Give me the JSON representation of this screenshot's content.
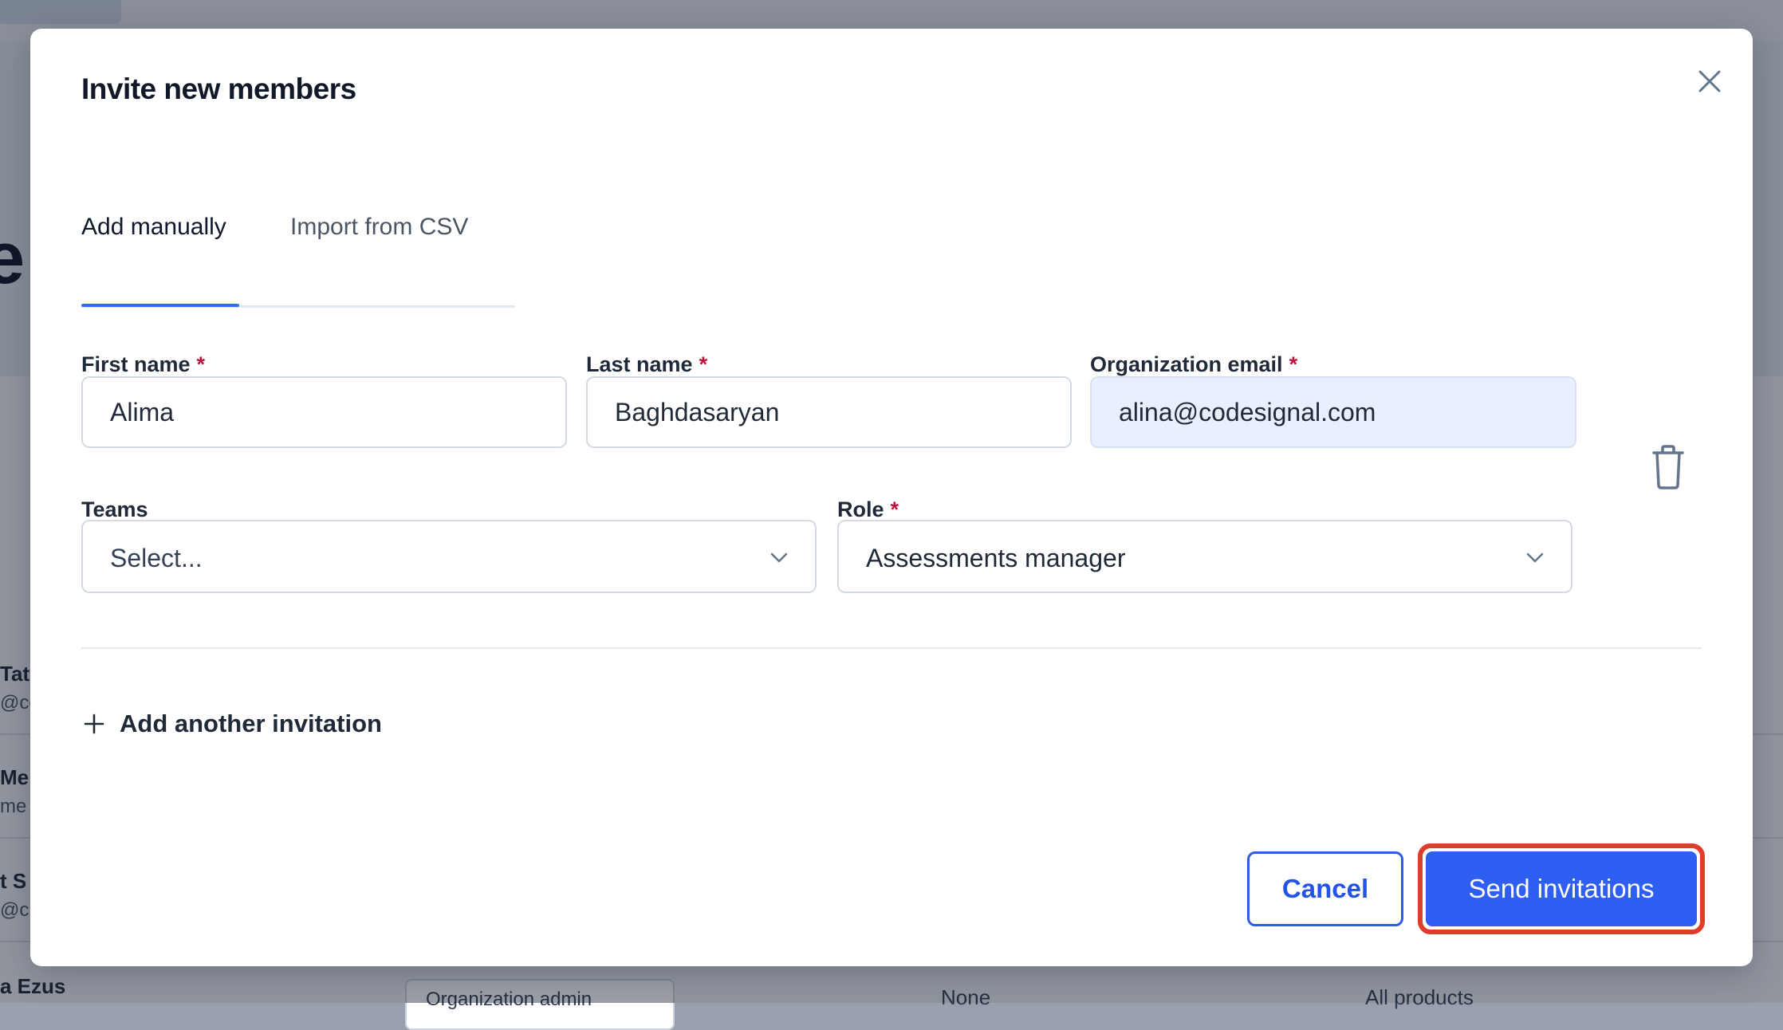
{
  "background": {
    "rows": [
      {
        "name": "Tat",
        "email": "@co"
      },
      {
        "name": "Me",
        "email": "me"
      },
      {
        "name": "t S",
        "email": "@c"
      }
    ],
    "last_row": {
      "name": "a Ezus",
      "role": "Organization admin",
      "teams": "None",
      "products": "All products"
    }
  },
  "modal": {
    "title": "Invite new members",
    "tabs": [
      {
        "label": "Add manually",
        "active": true
      },
      {
        "label": "Import from CSV",
        "active": false
      }
    ],
    "fields": {
      "first_name": {
        "label": "First name",
        "required_mark": "*",
        "value": "Alima"
      },
      "last_name": {
        "label": "Last name",
        "required_mark": "*",
        "value": "Baghdasaryan"
      },
      "email": {
        "label": "Organization email",
        "required_mark": "*",
        "value": "alina@codesignal.com"
      },
      "teams": {
        "label": "Teams",
        "value": "Select..."
      },
      "role": {
        "label": "Role",
        "required_mark": "*",
        "value": "Assessments manager"
      }
    },
    "add_another_label": "Add another invitation",
    "buttons": {
      "cancel": "Cancel",
      "send": "Send invitations"
    }
  },
  "colors": {
    "accent": "#2f5ff2",
    "required": "#be123c",
    "highlight": "#e23b2b"
  }
}
